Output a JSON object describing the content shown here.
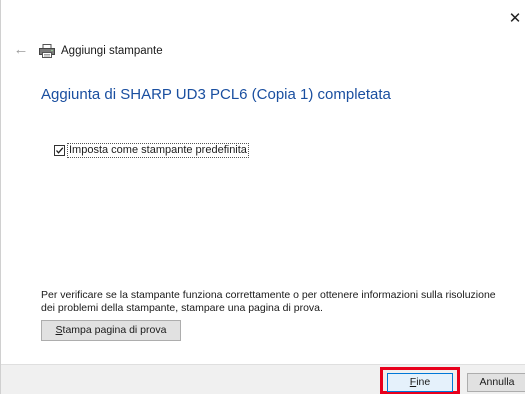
{
  "window": {
    "close_glyph": "✕",
    "back_glyph": "←"
  },
  "header": {
    "title": "Aggiungi stampante",
    "icon": "printer-icon"
  },
  "main": {
    "heading": "Aggiunta di SHARP UD3 PCL6 (Copia 1) completata",
    "default_printer": {
      "label": "Imposta come stampante predefinita",
      "checked": true
    },
    "info_text": "Per verificare se la stampante funziona correttamente o per ottenere informazioni sulla risoluzione dei problemi della stampante, stampare una pagina di prova.",
    "test_page_button": "Stampa pagina di prova"
  },
  "footer": {
    "finish_button": "Fine",
    "cancel_button": "Annulla",
    "highlight_color": "#e8001c"
  },
  "colors": {
    "heading": "#1a4fa0",
    "primary_button_border": "#0078d7"
  }
}
